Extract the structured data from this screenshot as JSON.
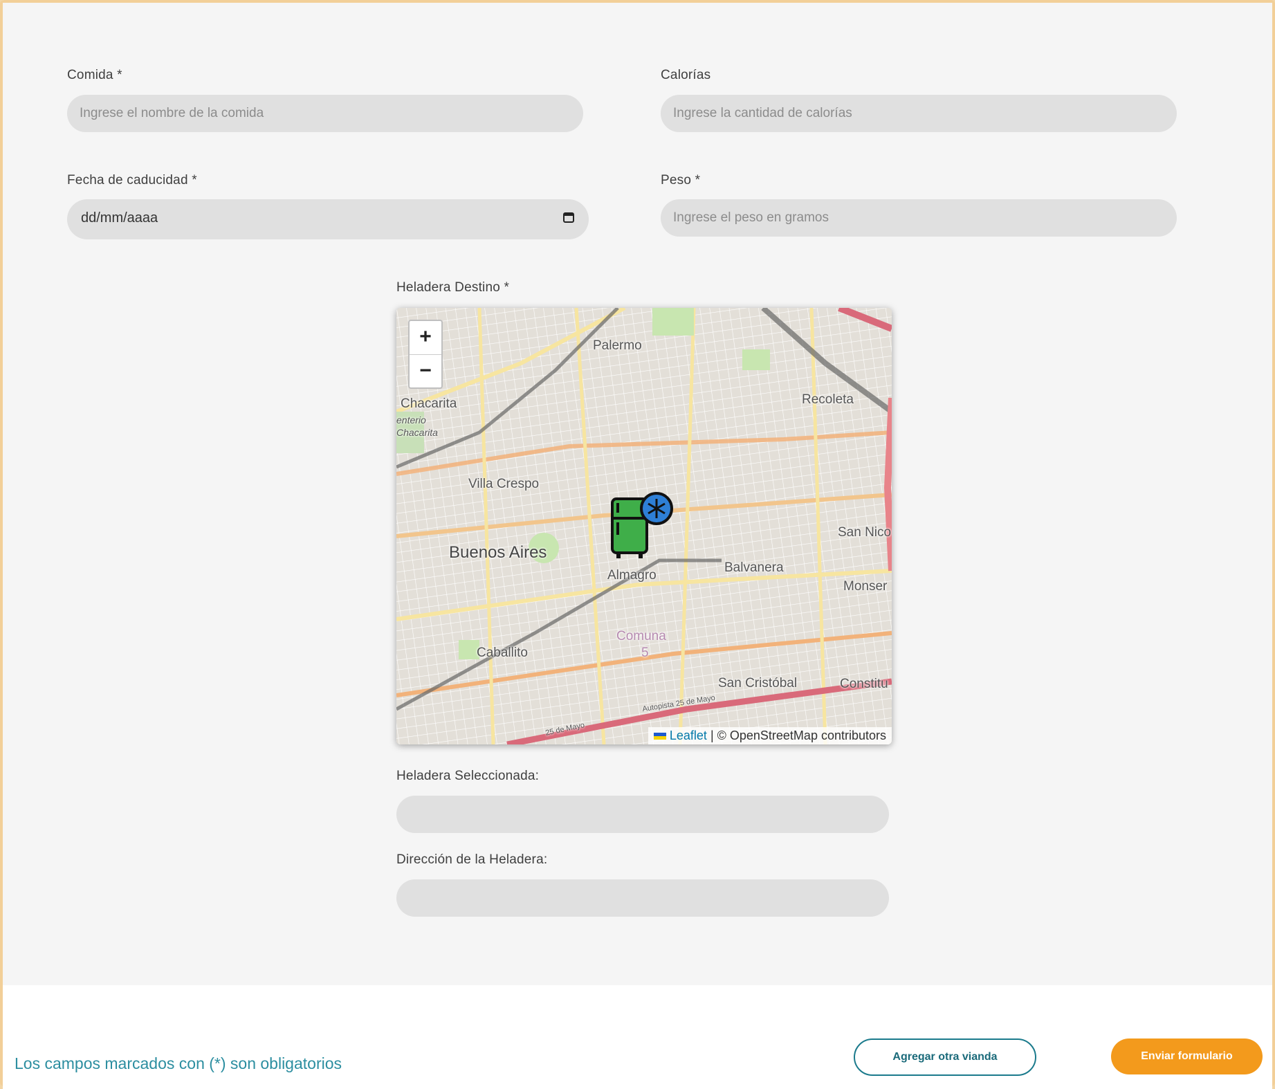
{
  "form": {
    "comida": {
      "label": "Comida *",
      "placeholder": "Ingrese el nombre de la comida"
    },
    "calorias": {
      "label": "Calorías",
      "placeholder": "Ingrese la cantidad de calorías"
    },
    "fecha": {
      "label": "Fecha de caducidad *",
      "value": "dd/mm/aaaa"
    },
    "peso": {
      "label": "Peso *",
      "placeholder": "Ingrese el peso en gramos"
    },
    "heladera_destino": {
      "label": "Heladera Destino *"
    },
    "heladera_seleccionada": {
      "label": "Heladera Seleccionada:",
      "value": ""
    },
    "direccion": {
      "label": "Dirección de la Heladera:",
      "value": ""
    }
  },
  "map": {
    "zoom_in": "+",
    "zoom_out": "−",
    "places": {
      "palermo": "Palermo",
      "chacarita": "Chacarita",
      "cementerio": "enterio",
      "chacarita2": "Chacarita",
      "recoleta": "Recoleta",
      "villa_crespo": "Villa Crespo",
      "san_nicolas": "San Nico",
      "buenos_aires": "Buenos Aires",
      "balvanera": "Balvanera",
      "almagro": "Almagro",
      "monserrat": "Monser",
      "comuna": "Comuna",
      "comuna_num": "5",
      "caballito": "Caballito",
      "san_cristobal": "San Cristóbal",
      "constitucion": "Constitu",
      "autopista": "Autopista 25 de Mayo",
      "autopista2": "25 de Mayo"
    },
    "attribution": {
      "leaflet": "Leaflet",
      "rest": " | © OpenStreetMap contributors"
    },
    "marker_icon": "fridge-snowflake-icon"
  },
  "footer": {
    "note": "Los campos marcados con (*) son obligatorios",
    "add_button": "Agregar otra vianda",
    "submit_button": "Enviar formulario"
  },
  "colors": {
    "accent": "#f39a1c",
    "teal": "#1a7a8c",
    "frame": "#f2cf98"
  }
}
